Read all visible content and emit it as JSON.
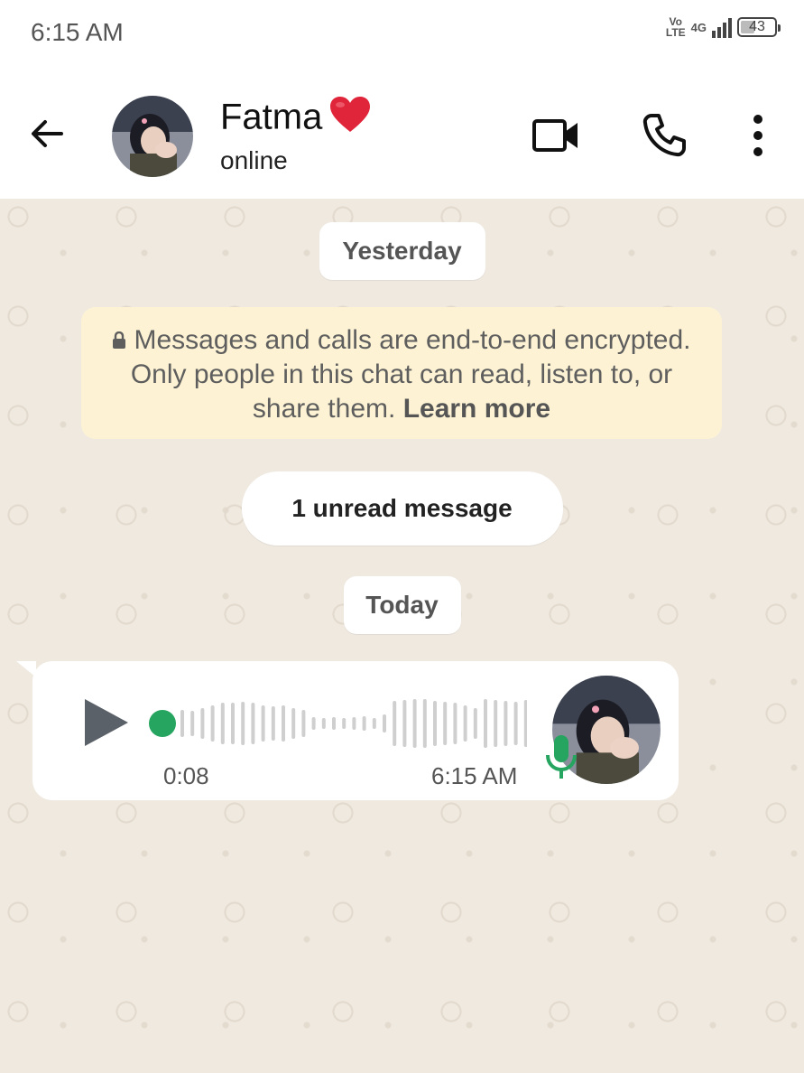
{
  "status_bar": {
    "time": "6:15 AM",
    "volte_top": "Vo",
    "volte_bottom": "LTE",
    "network": "4G",
    "battery": "43",
    "battery_level": 0.43
  },
  "header": {
    "contact_name": "Fatma",
    "contact_status": "online",
    "icons": {
      "back": "arrow-left-icon",
      "video": "video-camera-icon",
      "call": "phone-icon",
      "menu": "more-vertical-icon",
      "heart": "red-heart-emoji"
    }
  },
  "chat": {
    "date_yesterday": "Yesterday",
    "encryption_notice": "Messages and calls are end-to-end encrypted. Only people in this chat can read, listen to, or share them.",
    "learn_more": "Learn more",
    "unread_label": "1 unread message",
    "date_today": "Today",
    "voice_message": {
      "duration": "0:08",
      "time": "6:15 AM",
      "played": false,
      "progress": 0
    }
  },
  "colors": {
    "chat_background": "#efe9e0",
    "encryption_bg": "#fdf3d4",
    "accent_green": "#25a55f",
    "heart_red": "#e0253a"
  }
}
